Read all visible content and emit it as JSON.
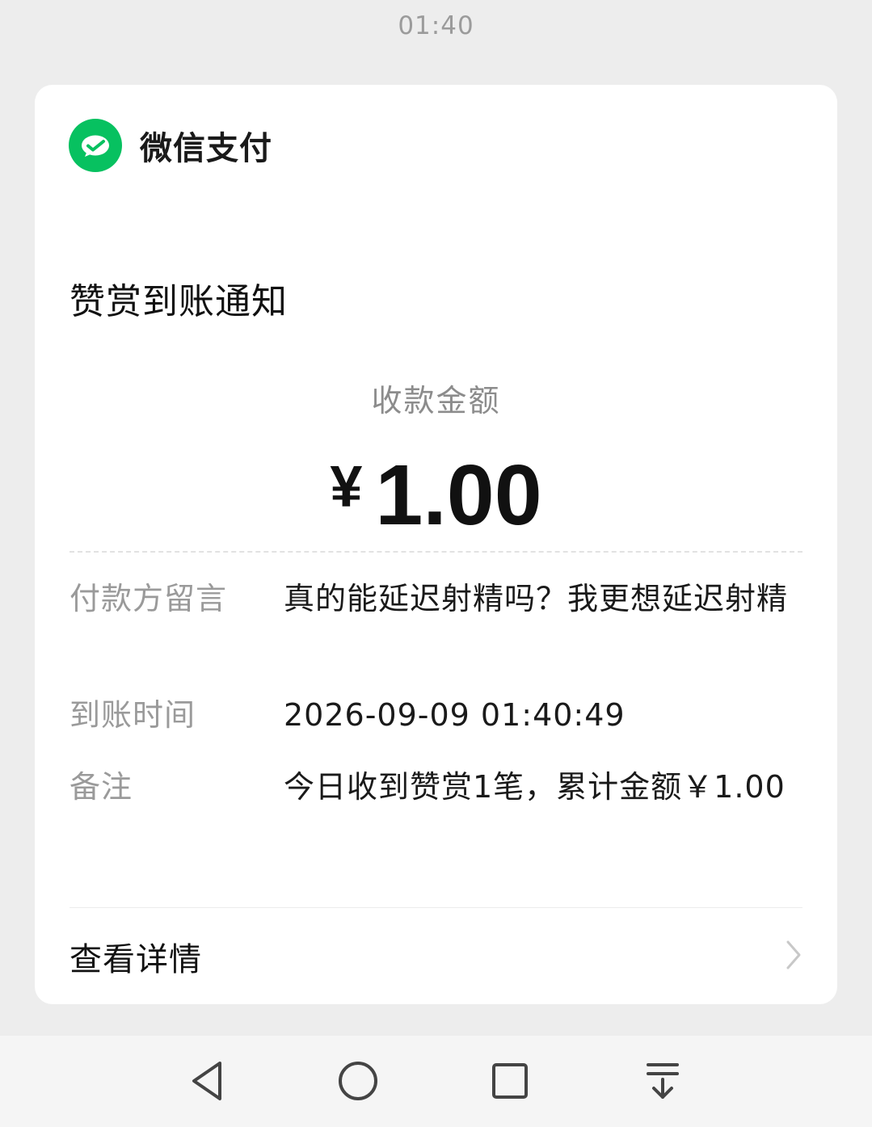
{
  "status_bar": {
    "time": "01:40"
  },
  "card": {
    "brand": "微信支付",
    "title": "赞赏到账通知",
    "amount_label": "收款金额",
    "amount_currency": "¥",
    "amount_value": "1.00",
    "rows": [
      {
        "key": "付款方留言",
        "value": "真的能延迟射精吗？我更想延迟射精"
      },
      {
        "key": "到账时间",
        "value": "2026-09-09 01:40:49"
      },
      {
        "key": "备注",
        "value": "今日收到赞赏1笔，累计金额￥1.00"
      }
    ],
    "detail_label": "查看详情"
  },
  "colors": {
    "brand_green": "#07c160",
    "background": "#ededed",
    "card": "#ffffff",
    "muted_text": "#9a9a9a"
  },
  "icons": {
    "logo": "wechat-pay-logo-icon",
    "detail_arrow": "chevron-right-icon",
    "nav": [
      "back-triangle-icon",
      "home-circle-icon",
      "recents-square-icon",
      "notification-pulldown-icon"
    ]
  }
}
